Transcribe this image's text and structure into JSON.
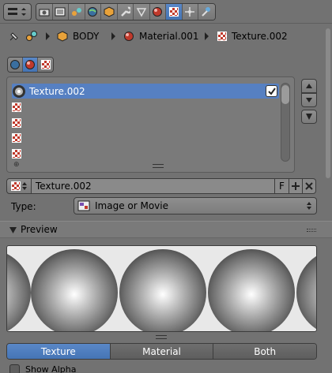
{
  "breadcrumb": {
    "items": [
      "BODY",
      "Material.001",
      "Texture.002"
    ]
  },
  "texture_slots": {
    "selected_label": "Texture.002",
    "slot_count": 5
  },
  "datablock": {
    "name": "Texture.002",
    "fake_user_label": "F"
  },
  "type_field": {
    "label": "Type:",
    "value": "Image or Movie"
  },
  "preview_panel": {
    "title": "Preview"
  },
  "preview_mode": {
    "options": [
      "Texture",
      "Material",
      "Both"
    ],
    "selected": "Texture"
  },
  "show_alpha": {
    "label": "Show Alpha",
    "checked": false
  },
  "colors": {
    "accent": "#5680c2",
    "background": "#727272",
    "checker_red": "#c0392b"
  }
}
